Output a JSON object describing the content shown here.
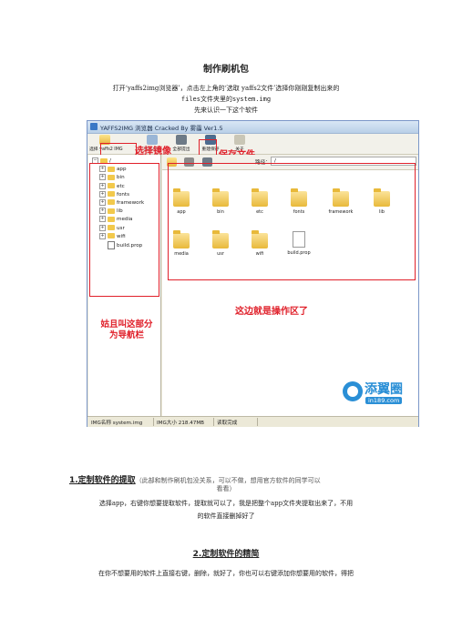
{
  "document": {
    "title": "制作刷机包",
    "intro_line1": "打开‘yaffs2img浏览器’，点击左上角的‘选取 yaffs2文件’选择你刚刚复制出来的",
    "intro_line2": "files文件夹里的system.img",
    "intro_line3": "先来认识一下这个软件",
    "section1_title": "1.定制软件的提取",
    "section1_note": "（此部和制作刷机包没关系，可以不做，想用官方软件的同学可以",
    "section1_note2": "看看）",
    "section1_body1": "选择app，右键你想要提取软件，提取就可以了，我是把整个app文件夹提取出来了，不用",
    "section1_body2": "的软件直接删掉好了",
    "section2_title": "2.定制软件的精简",
    "section2_body1": "在你不想要用的软件上直接右键，删除，就好了，你也可以右键添加你想要用的软件，得把"
  },
  "screenshot": {
    "window_title": "YAFFS2IMG 浏览器 Cracked By 雾霾 Ver1.5",
    "toolbar": {
      "select_label": "选择 yaffs2 IMG",
      "extract_label": "提取选中",
      "extract_all_label": "全部提出",
      "save_label": "重建保存",
      "about_label": "关于"
    },
    "annotations": {
      "select_image": "选择镜像",
      "save_file": "保存文件",
      "nav_line1": "姑且叫这部分",
      "nav_line2": "为导航栏",
      "operation_area": "这边就是操作区了"
    },
    "tree": {
      "root": "/",
      "items": [
        "app",
        "bin",
        "etc",
        "fonts",
        "framework",
        "lib",
        "media",
        "usr",
        "wifi",
        "build.prop"
      ]
    },
    "path_label": "路径：",
    "path_value": "/",
    "files": [
      "app",
      "bin",
      "etc",
      "fonts",
      "framework",
      "lib",
      "media",
      "usr",
      "wifi",
      "build.prop"
    ],
    "status": {
      "name": "IMG名称 system.img",
      "size": "IMG大小 218.47MB",
      "state": "读取完成"
    },
    "logo": {
      "cn": "添翼圈",
      "en": "in189.com"
    }
  }
}
